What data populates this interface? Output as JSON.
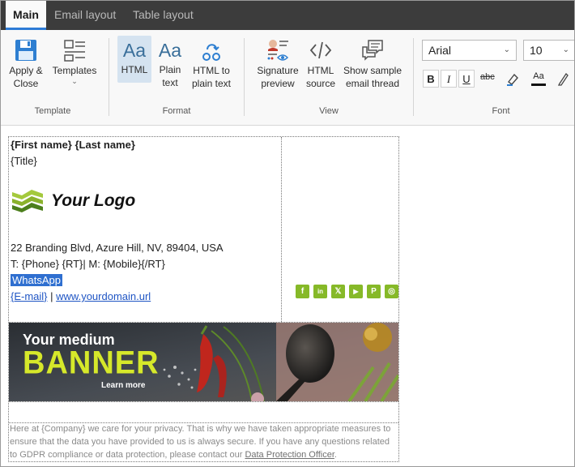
{
  "tabs": [
    {
      "label": "Main",
      "active": true
    },
    {
      "label": "Email layout",
      "active": false
    },
    {
      "label": "Table layout",
      "active": false
    }
  ],
  "ribbon": {
    "apply_close_label": "Apply &\nClose",
    "templates_label": "Templates",
    "group_template": "Template",
    "html_label": "HTML",
    "plain_text_label": "Plain\ntext",
    "html_to_plain_label": "HTML to\nplain text",
    "group_format": "Format",
    "signature_preview_label": "Signature\npreview",
    "html_source_label": "HTML\nsource",
    "show_sample_label": "Show sample\nemail thread",
    "group_view": "View",
    "font_family": "Arial",
    "font_size": "10",
    "bold": "B",
    "italic": "I",
    "underline": "U",
    "strike": "abc",
    "group_font": "Font"
  },
  "signature": {
    "name": "{First name} {Last name}",
    "title": "{Title}",
    "logo_text": "Your Logo",
    "address": "22 Branding Blvd, Azure Hill, NV, 89404, USA",
    "phone_line": "T: {Phone} {RT}| M: {Mobile}{/RT}",
    "whatsapp": "WhatsApp",
    "email": "{E-mail}",
    "separator": " | ",
    "website": "www.yourdomain.url",
    "social": [
      {
        "icon": "facebook-icon",
        "glyph": "f"
      },
      {
        "icon": "linkedin-icon",
        "glyph": "in"
      },
      {
        "icon": "x-icon",
        "glyph": "𝕏"
      },
      {
        "icon": "youtube-icon",
        "glyph": "▶"
      },
      {
        "icon": "pinterest-icon",
        "glyph": "P"
      },
      {
        "icon": "instagram-icon",
        "glyph": "◎"
      }
    ],
    "banner": {
      "line1": "Your medium",
      "line2": "BANNER",
      "cta": "Learn more"
    },
    "privacy_text": "Here at {Company} we care for your privacy. That is why we have taken appropriate measures to ensure that the data you have provided to us is always secure. If you have any questions related to GDPR compliance or data protection, please contact our ",
    "privacy_link": "Data Protection Officer",
    "privacy_end": "."
  },
  "colors": {
    "accent": "#2d7bd6",
    "social_green": "#86b928",
    "banner_yellow": "#d6e82a",
    "link": "#1f55c4"
  }
}
